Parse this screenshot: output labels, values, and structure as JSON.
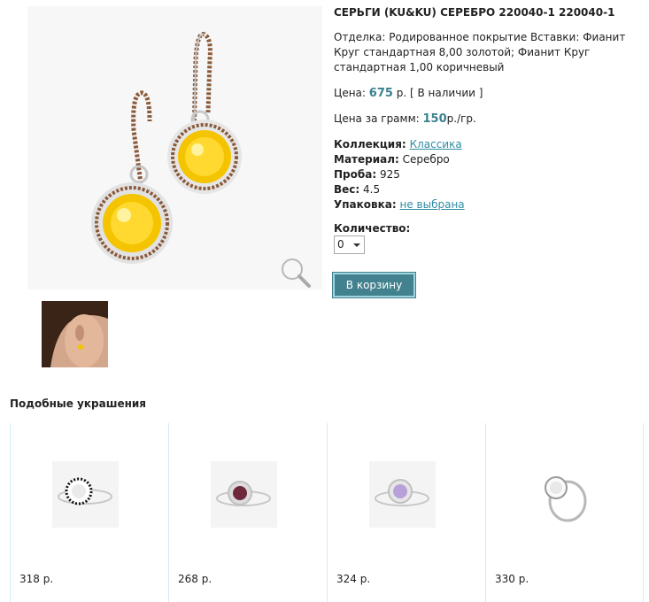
{
  "product": {
    "title": "СЕРЬГИ (KU&KU) СЕРЕБРО 220040-1 220040-1",
    "description": "Отделка: Родированное покрытие Вставки: Фианит Круг стандартная 8,00 золотой; Фианит Круг стандартная 1,00 коричневый",
    "price_label": "Цена:",
    "price_value": "675",
    "price_unit": "р.",
    "availability": "[ В наличии ]",
    "gram_label": "Цена за грамм:",
    "gram_value": "150",
    "gram_unit": "р./гр.",
    "collection_label": "Коллекция:",
    "collection_value": "Классика",
    "material_label": "Материал:",
    "material_value": "Серебро",
    "proba_label": "Проба:",
    "proba_value": "925",
    "weight_label": "Вес:",
    "weight_value": "4.5",
    "packaging_label": "Упаковка:",
    "packaging_value": "не выбрана",
    "quantity_label": "Количество:",
    "quantity_value": "0",
    "cart_button": "В корзину"
  },
  "similar": {
    "title": "Подобные украшения",
    "items": [
      {
        "price": "318 р.",
        "stone_color": "#ffffff",
        "accent": "#111111"
      },
      {
        "price": "268 р.",
        "stone_color": "#6e2a3c",
        "accent": "#d0d0d0"
      },
      {
        "price": "324 р.",
        "stone_color": "#b8a0d8",
        "accent": "#d0d0d0"
      },
      {
        "price": "330 р.",
        "stone_color": "#ffffff",
        "accent": "#c8c8c8"
      }
    ]
  },
  "colors": {
    "accent": "#42818e",
    "link": "#2f8da5",
    "gem_main": "#f5c400"
  }
}
